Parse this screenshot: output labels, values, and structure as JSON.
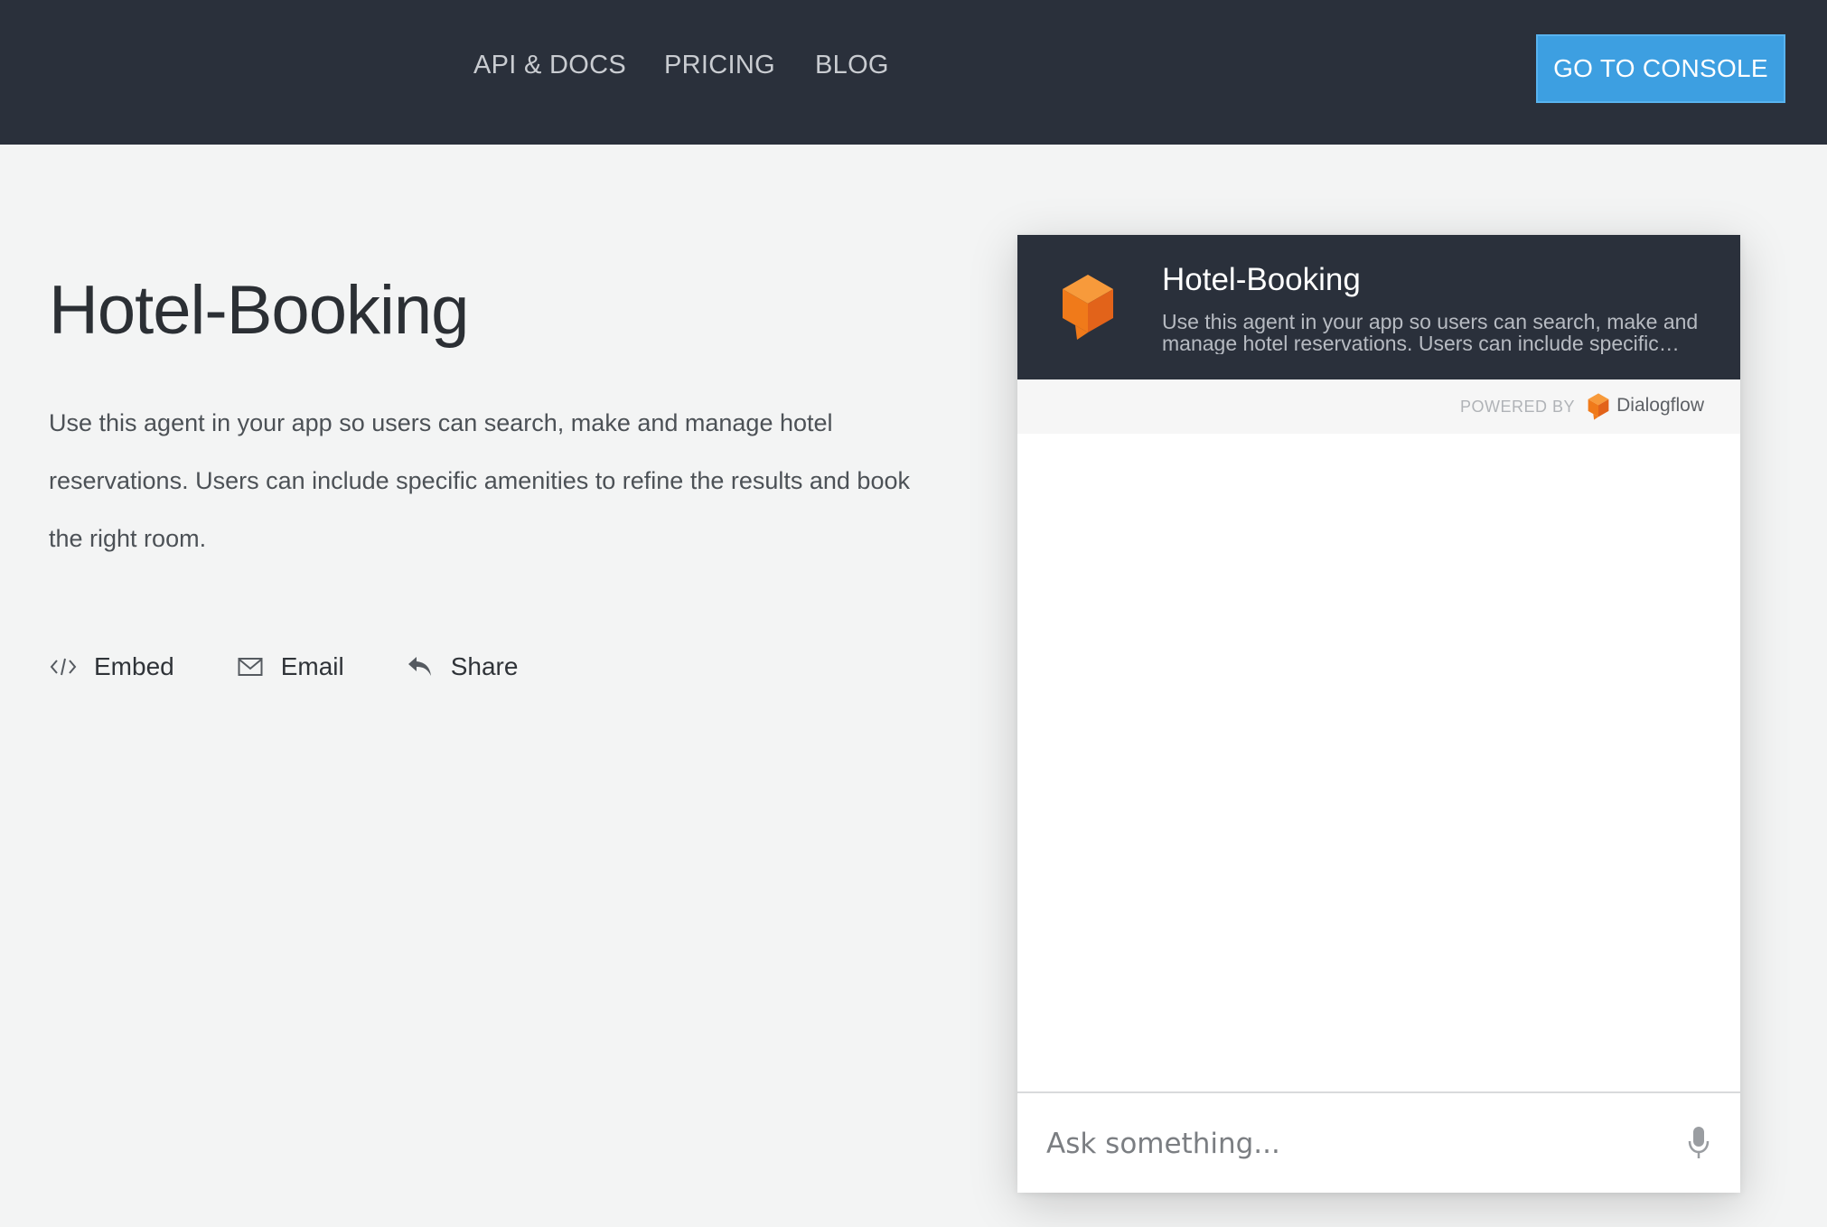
{
  "nav": {
    "links": [
      {
        "label": "API & DOCS"
      },
      {
        "label": "PRICING"
      },
      {
        "label": "BLOG"
      }
    ],
    "console_button": "GO TO CONSOLE"
  },
  "agent": {
    "title": "Hotel-Booking",
    "description": "Use this agent in your app so users can search, make and manage hotel reservations. Users can include specific amenities to refine the results and book the right room."
  },
  "actions": [
    {
      "label": "Embed",
      "icon": "code-icon"
    },
    {
      "label": "Email",
      "icon": "envelope-icon"
    },
    {
      "label": "Share",
      "icon": "reply-arrow-icon"
    }
  ],
  "widget": {
    "title": "Hotel-Booking",
    "description": "Use this agent in your app so users can search, make and manage hotel reservations. Users can include specific amenities to refine the results and book the right room.",
    "powered_by": "POWERED BY",
    "brand": "Dialogflow",
    "input_placeholder": "Ask something...",
    "icons": [
      "dialogflow-logo-icon",
      "microphone-icon"
    ]
  },
  "colors": {
    "header_bg": "#2a303b",
    "accent_blue": "#3d9fe1",
    "brand_orange": "#f57c1f",
    "page_bg": "#f3f4f4"
  }
}
